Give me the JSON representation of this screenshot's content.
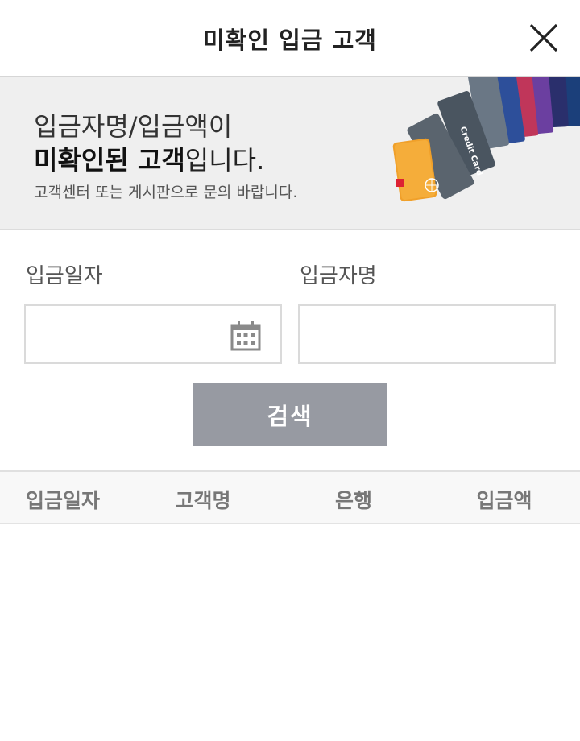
{
  "header": {
    "title": "미확인 입금 고객"
  },
  "banner": {
    "line1": "입금자명/입금액이",
    "line2_bold": "미확인된 고객",
    "line2_rest": "입니다.",
    "line3": "고객센터 또는 게시판으로 문의 바랍니다."
  },
  "form": {
    "date_label": "입금일자",
    "date_value": "",
    "name_label": "입금자명",
    "name_value": "",
    "search_label": "검색"
  },
  "table": {
    "columns": [
      "입금일자",
      "고객명",
      "은행",
      "입금액"
    ],
    "rows": []
  },
  "icons": {
    "close": "close-icon",
    "calendar": "calendar-icon"
  }
}
